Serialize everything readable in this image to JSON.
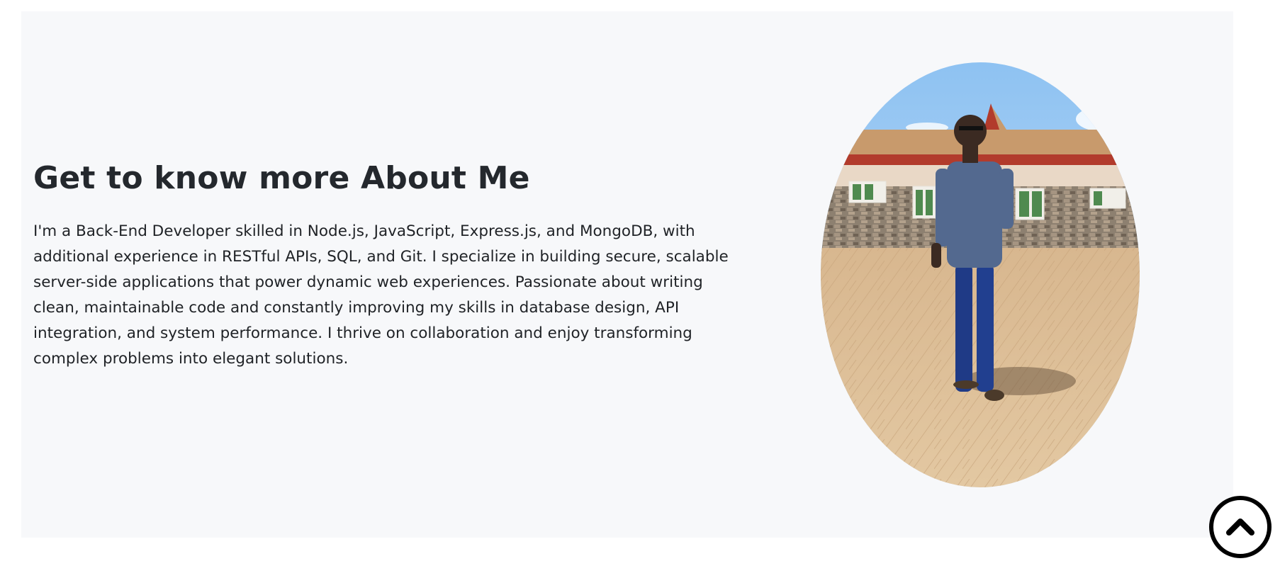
{
  "about": {
    "title": "Get to know more About Me",
    "paragraph": "I'm a Back-End Developer skilled in Node.js, JavaScript, Express.js, and MongoDB, with additional experience in RESTful APIs, SQL, and Git. I specialize in building secure, scalable server-side applications that power dynamic web experiences. Passionate about writing clean, maintainable code and constantly improving my skills in database design, API integration, and system performance. I thrive on collaboration and enjoy transforming complex problems into elegant solutions."
  },
  "icons": {
    "scroll_top": "chevron-up-icon"
  },
  "colors": {
    "section_bg": "#f7f8fa",
    "heading": "#24282d",
    "text": "#1f2226"
  }
}
